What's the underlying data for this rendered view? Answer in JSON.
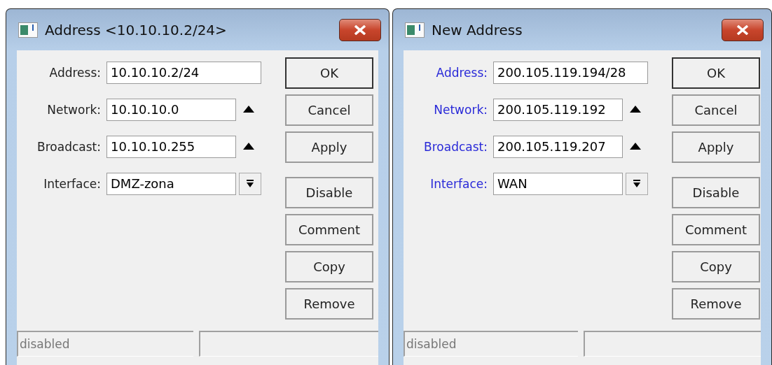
{
  "windows": [
    {
      "title": "Address <10.10.10.2/24>",
      "fields": [
        {
          "label": "Address:",
          "value": "10.10.10.2/24",
          "kind": "text",
          "changed": false
        },
        {
          "label": "Network:",
          "value": "10.10.10.0",
          "kind": "spin",
          "changed": false
        },
        {
          "label": "Broadcast:",
          "value": "10.10.10.255",
          "kind": "spin",
          "changed": false
        },
        {
          "label": "Interface:",
          "value": "DMZ-zona",
          "kind": "dropdown",
          "changed": false
        }
      ],
      "buttons": [
        {
          "label": "OK",
          "default": true
        },
        {
          "label": "Cancel",
          "default": false
        },
        {
          "label": "Apply",
          "default": false
        },
        {
          "label": "Disable",
          "default": false
        },
        {
          "label": "Comment",
          "default": false
        },
        {
          "label": "Copy",
          "default": false
        },
        {
          "label": "Remove",
          "default": false
        }
      ],
      "status_bar": [
        "disabled"
      ]
    },
    {
      "title": "New Address",
      "fields": [
        {
          "label": "Address:",
          "value": "200.105.119.194/28",
          "kind": "text",
          "changed": true
        },
        {
          "label": "Network:",
          "value": "200.105.119.192",
          "kind": "spin",
          "changed": true
        },
        {
          "label": "Broadcast:",
          "value": "200.105.119.207",
          "kind": "spin",
          "changed": true
        },
        {
          "label": "Interface:",
          "value": "WAN",
          "kind": "dropdown",
          "changed": true
        }
      ],
      "buttons": [
        {
          "label": "OK",
          "default": true
        },
        {
          "label": "Cancel",
          "default": false
        },
        {
          "label": "Apply",
          "default": false
        },
        {
          "label": "Disable",
          "default": false
        },
        {
          "label": "Comment",
          "default": false
        },
        {
          "label": "Copy",
          "default": false
        },
        {
          "label": "Remove",
          "default": false
        }
      ],
      "status_bar": [
        "disabled"
      ]
    }
  ]
}
